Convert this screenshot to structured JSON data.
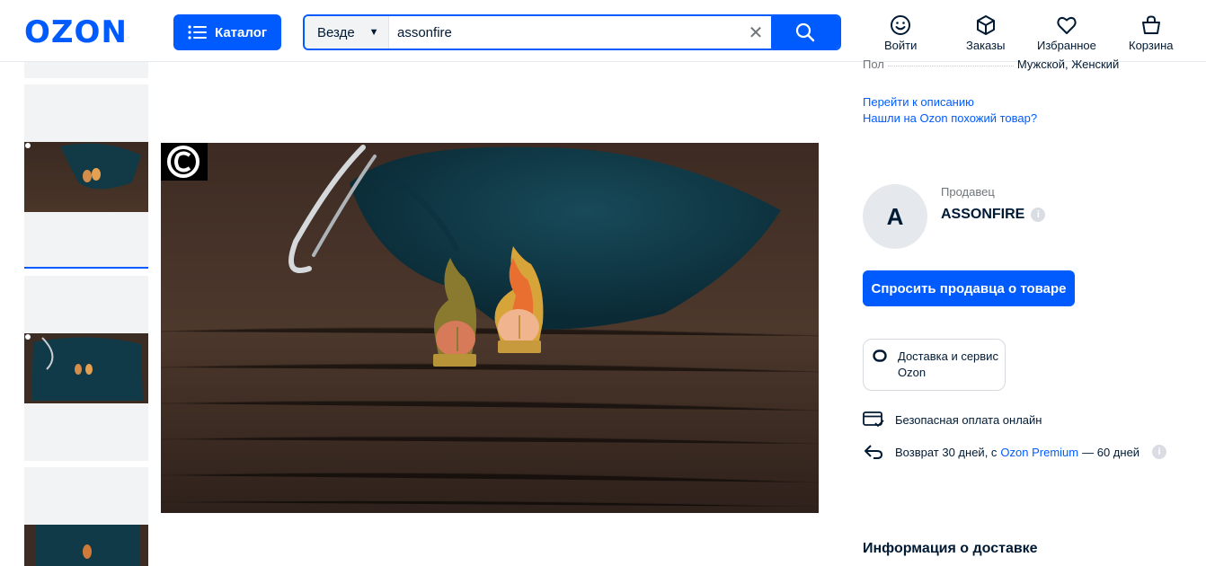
{
  "header": {
    "logo": "OZON",
    "catalog_label": "Каталог",
    "search": {
      "scope": "Везде",
      "query": "assonfire"
    },
    "nav": [
      {
        "label": "Войти",
        "icon": "smile-icon"
      },
      {
        "label": "Заказы",
        "icon": "box-icon"
      },
      {
        "label": "Избранное",
        "icon": "heart-icon"
      },
      {
        "label": "Корзина",
        "icon": "basket-icon"
      }
    ]
  },
  "gallery": {
    "thumbnails": [
      "jewelry-pins-on-table",
      "jewelry-pins-on-pouch",
      "jewelry-pin-on-pouch"
    ],
    "active_index": 0,
    "copyright_badge": "©"
  },
  "product": {
    "property": {
      "name": "Пол",
      "value": "Мужской, Женский"
    },
    "links": [
      "Перейти к описанию",
      "Нашли на Ozon похожий товар?"
    ]
  },
  "seller": {
    "caption": "Продавец",
    "avatar_letter": "A",
    "name": "ASSONFIRE",
    "ask_button": "Спросить продавца о товаре"
  },
  "services": {
    "delivery_card": "Доставка и сервис Ozon",
    "secure_payment": "Безопасная оплата онлайн",
    "return_text_before": "Возврат 30 дней, с",
    "return_link": "Ozon Premium",
    "return_text_after": "— 60 дней"
  },
  "delivery_info_title": "Информация о доставке",
  "colors": {
    "brand": "#005bff",
    "text": "#001a34",
    "muted": "#70757a"
  }
}
